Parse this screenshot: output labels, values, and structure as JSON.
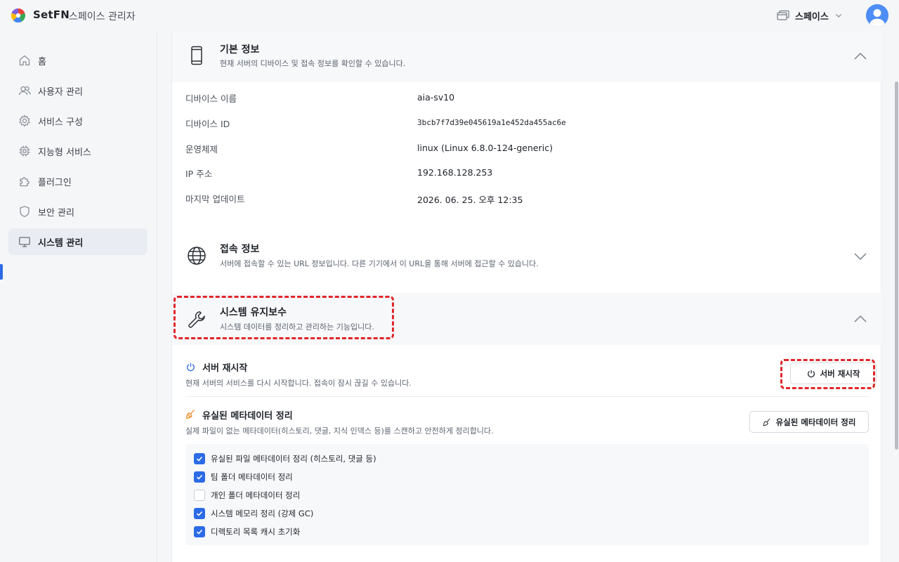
{
  "app": {
    "brand": "SetFN",
    "subtitle": "스페이스 관리자"
  },
  "header": {
    "space_label": "스페이스",
    "space_icon": "window-stack-icon",
    "avatar_icon": "user-avatar-icon",
    "avatar_color": "#4e8df5"
  },
  "sidebar": {
    "items": [
      {
        "label": "홈",
        "icon": "home-icon"
      },
      {
        "label": "사용자 관리",
        "icon": "users-icon"
      },
      {
        "label": "서비스 구성",
        "icon": "gear-icon"
      },
      {
        "label": "지능형 서비스",
        "icon": "chip-icon"
      },
      {
        "label": "플러그인",
        "icon": "puzzle-icon"
      },
      {
        "label": "보안 관리",
        "icon": "shield-icon"
      },
      {
        "label": "시스템 관리",
        "icon": "monitor-icon",
        "active": true
      }
    ]
  },
  "basic_info": {
    "title": "기본 정보",
    "desc": "현재 서버의 디바이스 및 접속 정보를 확인할 수 있습니다.",
    "expanded": true,
    "rows": [
      {
        "label": "디바이스 이름",
        "value": "aia-sv10"
      },
      {
        "label": "디바이스 ID",
        "value": "3bcb7f7d39e045619a1e452da455ac6e"
      },
      {
        "label": "운영체제",
        "value": "linux (Linux 6.8.0-124-generic)"
      },
      {
        "label": "IP 주소",
        "value": "192.168.128.253"
      },
      {
        "label": "마지막 업데이트",
        "value": "2026. 06. 25. 오후 12:35"
      }
    ]
  },
  "connection_info": {
    "title": "접속 정보",
    "desc": "서버에 접속할 수 있는 URL 정보입니다. 다른 기기에서 이 URL을 통해 서버에 접근할 수 있습니다.",
    "expanded": false
  },
  "maintenance": {
    "title": "시스템 유지보수",
    "desc": "시스템 데이터를 정리하고 관리하는 기능입니다.",
    "expanded": true,
    "restart": {
      "title": "서버 재시작",
      "desc": "현재 서버의 서비스를 다시 시작합니다. 접속이 잠시 끊길 수 있습니다.",
      "button": "서버 재시작"
    },
    "cleanup": {
      "title": "유실된 메타데이터 정리",
      "desc": "실제 파일이 없는 메타데이터(히스토리, 댓글, 지식 인덱스 등)를 스캔하고 안전하게 정리합니다.",
      "button": "유실된 메타데이터 정리",
      "options": [
        {
          "label": "유실된 파일 메타데이터 정리 (히스토리, 댓글 등)",
          "checked": true
        },
        {
          "label": "팀 폴더 메타데이터 정리",
          "checked": true
        },
        {
          "label": "개인 폴더 메타데이터 정리",
          "checked": false
        },
        {
          "label": "시스템 메모리 정리 (강제 GC)",
          "checked": true
        },
        {
          "label": "디렉토리 목록 캐시 초기화",
          "checked": true
        }
      ]
    }
  },
  "colors": {
    "accent": "#2c6be6",
    "highlight": "#e0262a",
    "cleanup_icon": "#f08a24",
    "restart_icon": "#2c6be6"
  }
}
